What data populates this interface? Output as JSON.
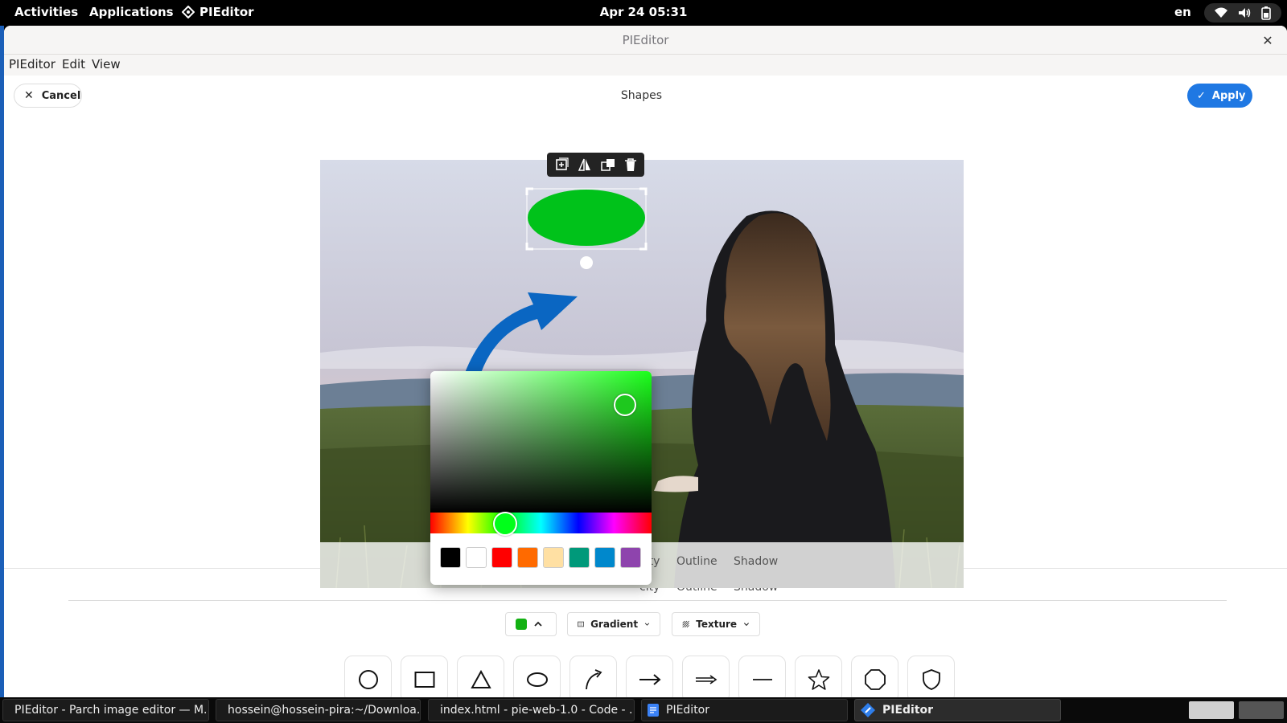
{
  "topbar": {
    "activities": "Activities",
    "applications": "Applications",
    "app_menu": "PIEditor",
    "clock": "Apr 24  05:31",
    "lang": "en"
  },
  "window": {
    "title": "PIEditor",
    "menu": [
      "PIEditor",
      "Edit",
      "View"
    ]
  },
  "header": {
    "cancel_label": "Cancel",
    "panel_title": "Shapes",
    "apply_label": "Apply"
  },
  "tabs": [
    "city",
    "Outline",
    "Shadow"
  ],
  "tools": {
    "fill_color": "#13b113",
    "gradient_label": "Gradient",
    "texture_label": "Texture"
  },
  "shapes": [
    "circle-icon",
    "rectangle-icon",
    "triangle-icon",
    "ellipse-icon",
    "curved-arrow-icon",
    "arrow-icon",
    "double-line-arrow-icon",
    "line-icon",
    "star-icon",
    "hexagon-icon",
    "shield-icon"
  ],
  "color_picker": {
    "selected_color": "#1ec81e",
    "swatches": [
      "#000000",
      "#ffffff",
      "#ff0000",
      "#ff6a00",
      "#ffe0a3",
      "#00997a",
      "#0088cc",
      "#8e44ad"
    ]
  },
  "canvas": {
    "ellipse_color": "#00c21a",
    "arrow_color": "#0a66c2"
  },
  "taskbar": [
    {
      "label": "PIEditor - Parch image editor — M...",
      "icon": "firefox-icon",
      "active": false
    },
    {
      "label": "hossein@hossein-pira:~/Downloa...",
      "icon": "terminal-icon",
      "active": false
    },
    {
      "label": "index.html - pie-web-1.0 - Code - ...",
      "icon": "code-editor-icon",
      "active": false
    },
    {
      "label": "PIEditor",
      "icon": "document-icon",
      "active": false
    },
    {
      "label": "PIEditor",
      "icon": "pieditor-icon",
      "active": true
    }
  ]
}
